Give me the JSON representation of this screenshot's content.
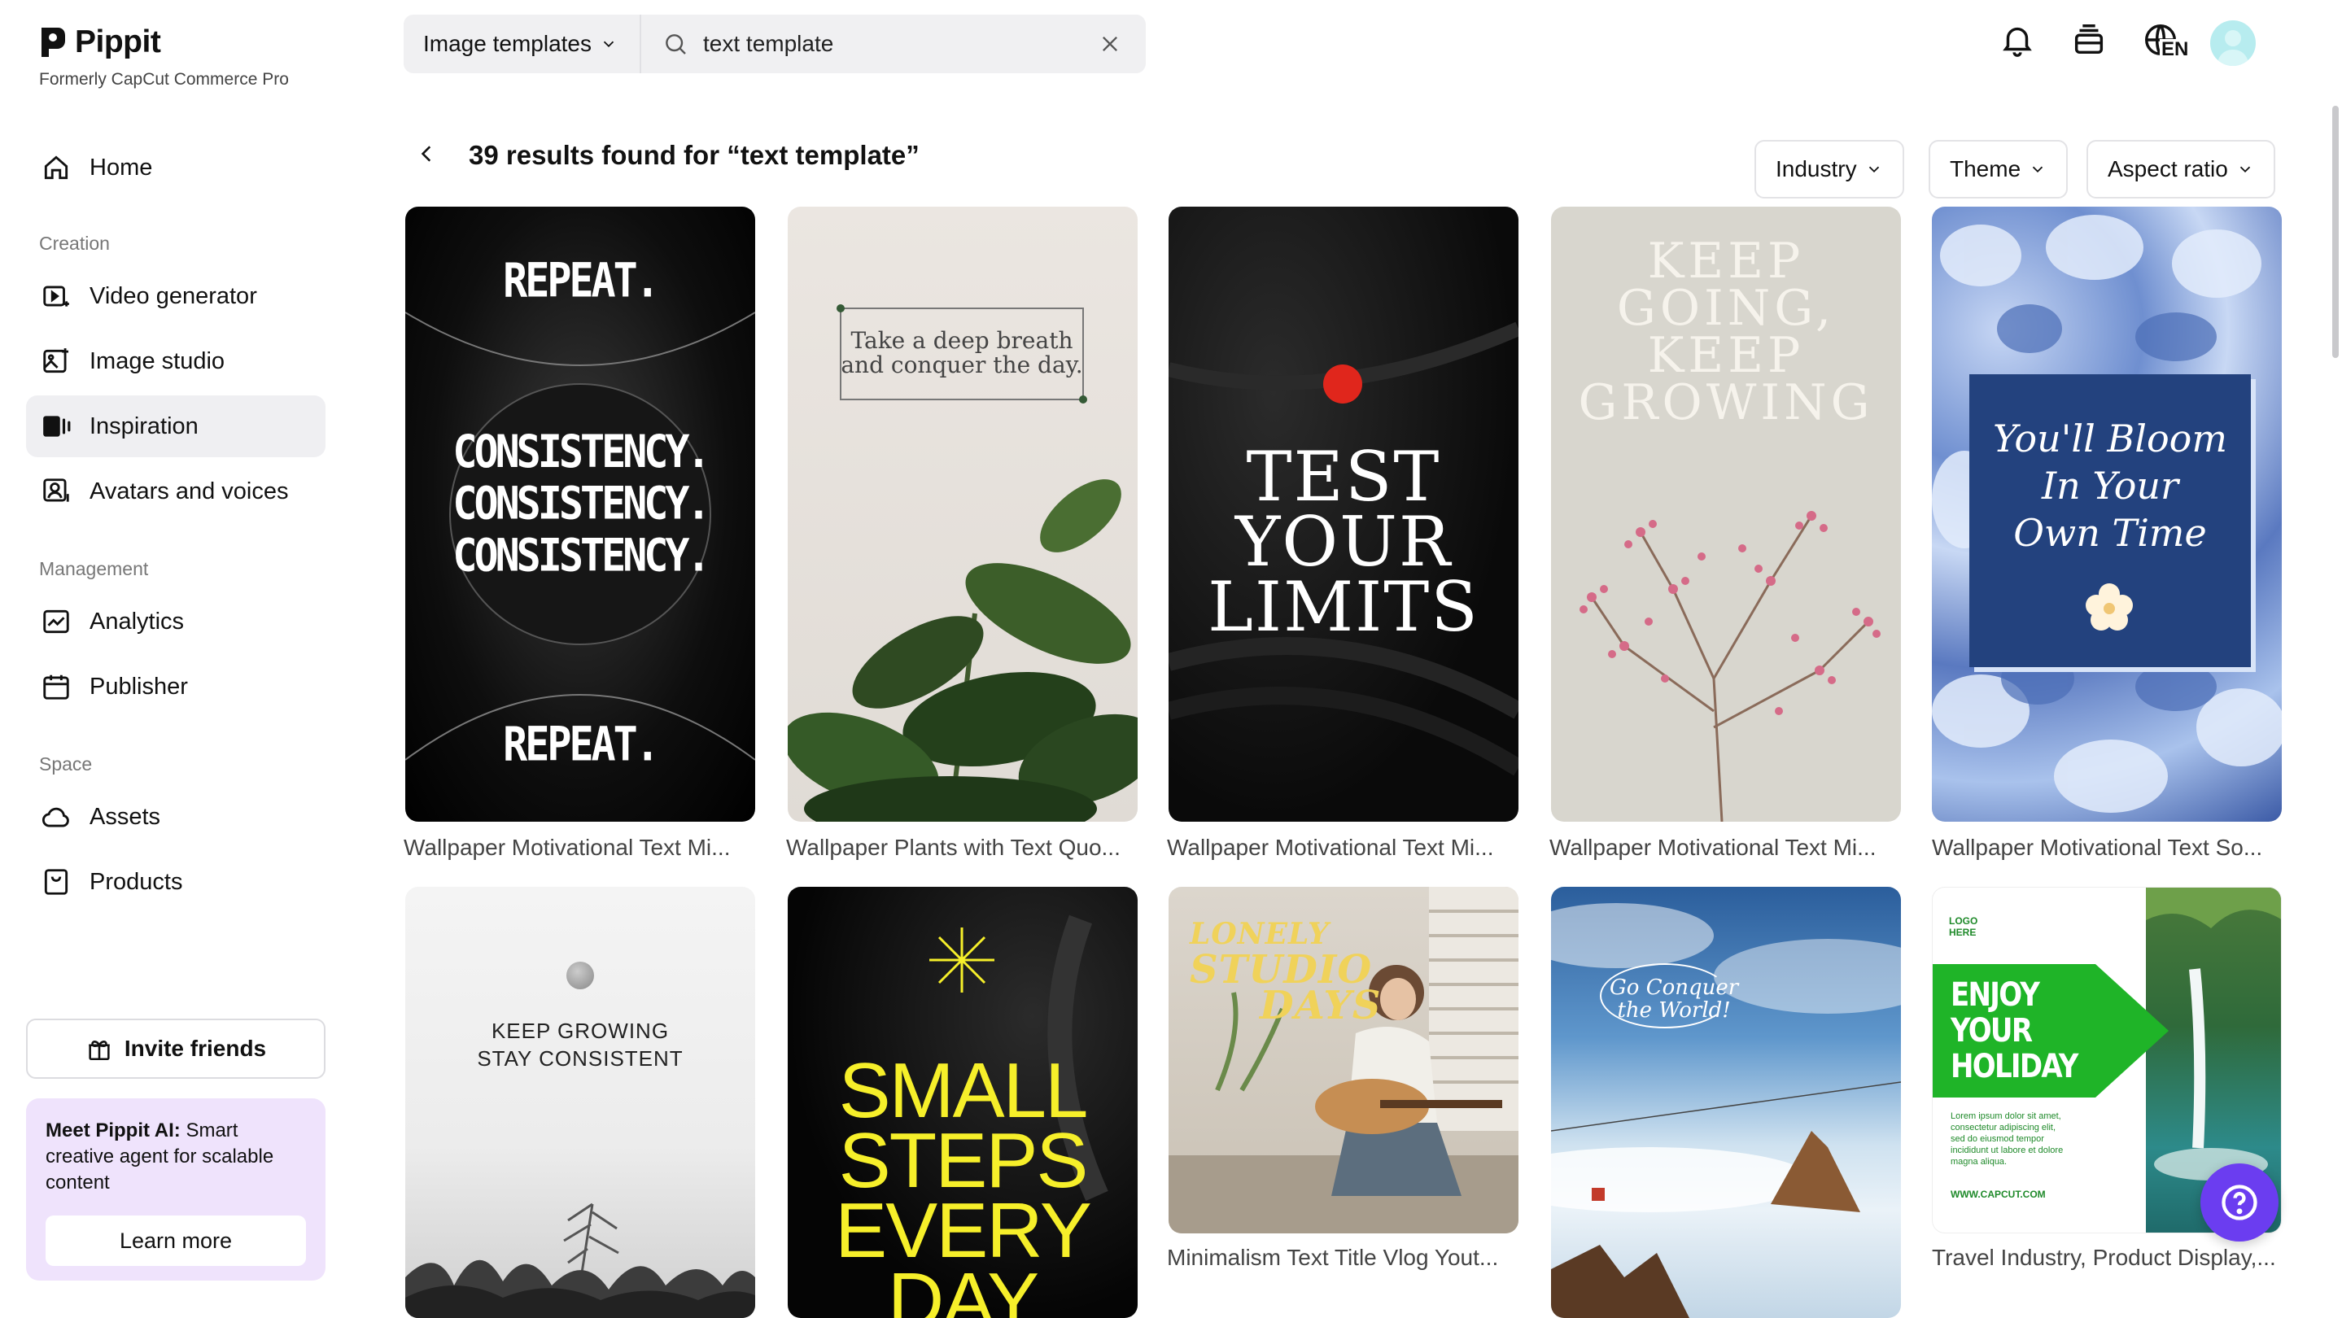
{
  "brand": {
    "name": "Pippit",
    "subtitle": "Formerly CapCut Commerce Pro"
  },
  "sidebar": {
    "home": "Home",
    "sections": {
      "creation": "Creation",
      "management": "Management",
      "space": "Space"
    },
    "creation_items": [
      "Video generator",
      "Image studio",
      "Inspiration",
      "Avatars and voices"
    ],
    "active_item": "Inspiration",
    "management_items": [
      "Analytics",
      "Publisher"
    ],
    "space_items": [
      "Assets",
      "Products"
    ],
    "invite": "Invite friends",
    "promo": {
      "bold": "Meet Pippit AI:",
      "text": " Smart creative agent for scalable content",
      "button": "Learn more"
    }
  },
  "search": {
    "type_label": "Image templates",
    "query": "text template"
  },
  "topbar": {
    "language": "EN"
  },
  "results": {
    "title": "39 results found for “text template”"
  },
  "filters": [
    "Industry",
    "Theme",
    "Aspect ratio"
  ],
  "cards": [
    {
      "title": "Wallpaper Motivational Text Mi...",
      "lines": [
        "REPEAT.",
        "CONSISTENCY.",
        "CONSISTENCY.",
        "CONSISTENCY.",
        "REPEAT."
      ]
    },
    {
      "title": "Wallpaper Plants with Text Quo...",
      "lines": [
        "Take a deep breath",
        "and conquer the day."
      ]
    },
    {
      "title": "Wallpaper Motivational Text Mi...",
      "lines": [
        "TEST",
        "YOUR",
        "LIMITS"
      ]
    },
    {
      "title": "Wallpaper Motivational Text Mi...",
      "lines": [
        "KEEP",
        "GOING,",
        "KEEP",
        "GROWING"
      ]
    },
    {
      "title": "Wallpaper Motivational Text So...",
      "lines": [
        "You'll Bloom",
        "In Your",
        "Own Time"
      ]
    },
    {
      "title": "",
      "lines": [
        "KEEP GROWING",
        "STAY CONSISTENT"
      ]
    },
    {
      "title": "",
      "lines": [
        "SMALL",
        "STEPS",
        "EVERY",
        "DAY"
      ]
    },
    {
      "title": "Minimalism Text Title Vlog Yout...",
      "lines": [
        "LONELY",
        "STUDIO",
        "DAYS"
      ]
    },
    {
      "title": "",
      "lines": [
        "Go Conquer",
        "the World!"
      ]
    },
    {
      "title": "Travel Industry, Product Display,...",
      "lines": [
        "LOGO",
        "HERE",
        "ENJOY",
        "YOUR",
        "HOLIDAY",
        "Lorem ipsum dolor sit amet,",
        "consectetur adipiscing elit,",
        "sed do eiusmod tempor",
        "incididunt ut labore et dolore",
        "magna aliqua.",
        "WWW.CAPCUT.COM"
      ]
    }
  ]
}
